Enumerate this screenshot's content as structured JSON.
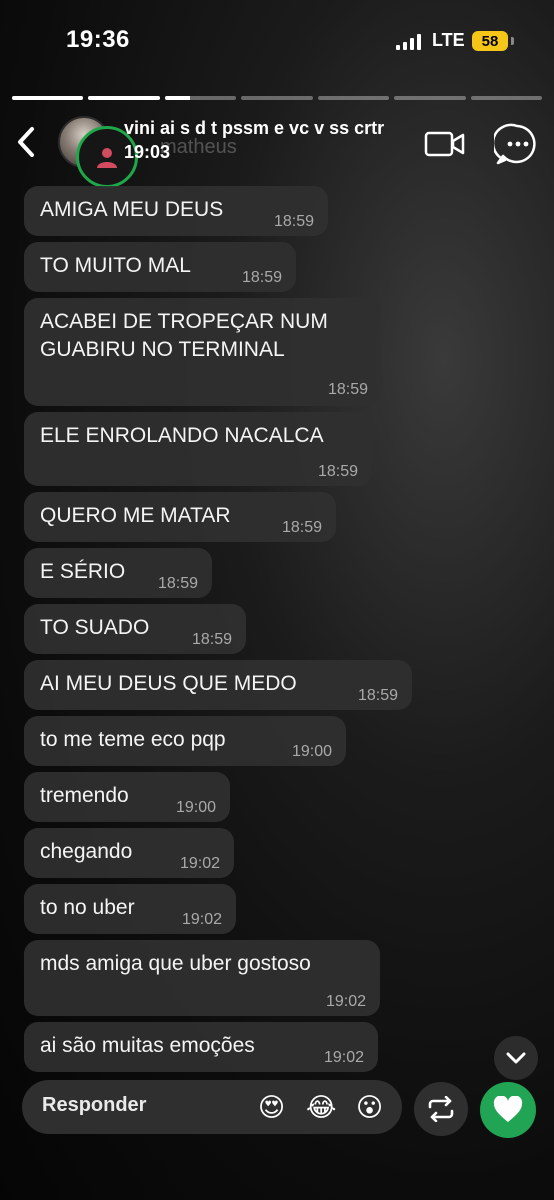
{
  "status_bar": {
    "time": "19:36",
    "network": "LTE",
    "battery": "58",
    "icons": [
      "signal-icon",
      "battery-icon"
    ]
  },
  "story_progress": {
    "segments": [
      1,
      1,
      0.35,
      0,
      0,
      0,
      0
    ]
  },
  "header": {
    "title": "vini ai s d t pssm e vc v ss crtr",
    "time": "19:03",
    "overlay_name": "matheus",
    "icons": [
      "back-icon",
      "avatar",
      "profile-icon",
      "video-call-icon",
      "chat-options-icon"
    ]
  },
  "messages": [
    {
      "text": "AMIGA MEU DEUS",
      "time": "18:59"
    },
    {
      "text": "TO MUITO MAL",
      "time": "18:59"
    },
    {
      "text": "ACABEI DE TROPEÇAR NUM GUABIRU NO TERMINAL",
      "time": "18:59"
    },
    {
      "text": "ELE ENROLANDO NACALCA",
      "time": "18:59"
    },
    {
      "text": "QUERO ME MATAR",
      "time": "18:59"
    },
    {
      "text": "E SÉRIO",
      "time": "18:59"
    },
    {
      "text": "TO SUADO",
      "time": "18:59"
    },
    {
      "text": "AI MEU DEUS QUE MEDO",
      "time": "18:59"
    },
    {
      "text": "to me teme eco pqp",
      "time": "19:00"
    },
    {
      "text": "tremendo",
      "time": "19:00"
    },
    {
      "text": "chegando",
      "time": "19:02"
    },
    {
      "text": "to no uber",
      "time": "19:02"
    },
    {
      "text": "mds amiga que uber gostoso",
      "time": "19:02"
    },
    {
      "text": "ai são muitas emoções",
      "time": "19:02"
    }
  ],
  "reply_bar": {
    "label": "Responder",
    "emojis": [
      "😍",
      "😂",
      "😮"
    ],
    "icons": [
      "scroll-down-icon",
      "repost-icon",
      "heart-icon"
    ]
  },
  "colors": {
    "bubble": "#303030",
    "accent_green": "#21a453",
    "battery": "#f5c518"
  }
}
